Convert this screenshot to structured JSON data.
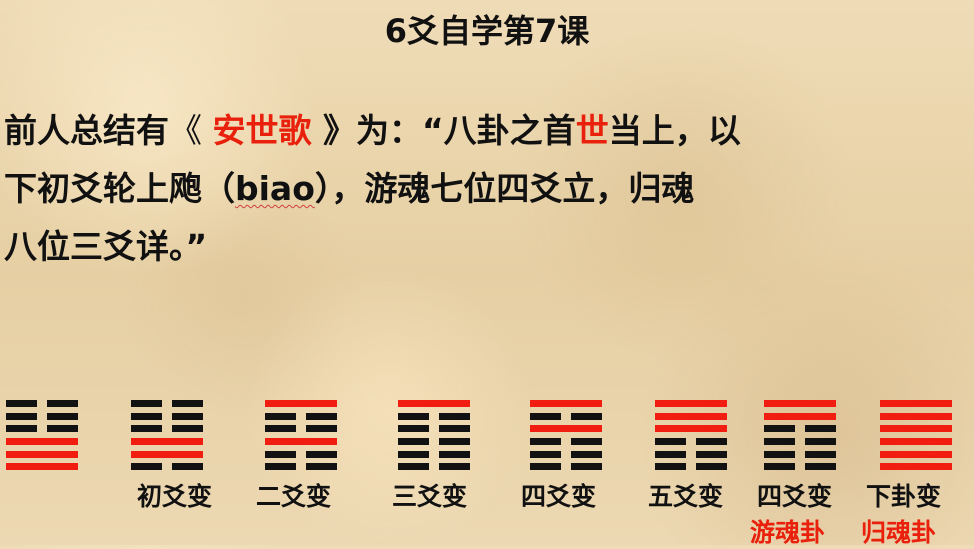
{
  "title": "6爻自学第7课",
  "paragraph": {
    "line1": {
      "a": "前人总结有",
      "b": "《 ",
      "c": "安世歌",
      "d": " 》为：“八卦之首",
      "e": "世",
      "f": "当上，以"
    },
    "line2": {
      "a": "下初爻轮上飑（",
      "b": "biao",
      "c": "），游魂七位四爻立，归魂"
    },
    "line3": {
      "a": "八位三爻详。”"
    }
  },
  "hexagrams": [
    {
      "label": "",
      "lines_bottom_to_top": [
        [
          "solid",
          "red"
        ],
        [
          "solid",
          "red"
        ],
        [
          "solid",
          "red"
        ],
        [
          "broken",
          "black"
        ],
        [
          "broken",
          "black"
        ],
        [
          "broken",
          "black"
        ]
      ]
    },
    {
      "label": "初爻变",
      "lines_bottom_to_top": [
        [
          "broken",
          "black"
        ],
        [
          "solid",
          "red"
        ],
        [
          "solid",
          "red"
        ],
        [
          "broken",
          "black"
        ],
        [
          "broken",
          "black"
        ],
        [
          "broken",
          "black"
        ]
      ]
    },
    {
      "label": "二爻变",
      "lines_bottom_to_top": [
        [
          "broken",
          "black"
        ],
        [
          "broken",
          "black"
        ],
        [
          "solid",
          "red"
        ],
        [
          "broken",
          "black"
        ],
        [
          "broken",
          "black"
        ],
        [
          "solid",
          "red"
        ]
      ]
    },
    {
      "label": "三爻变",
      "lines_bottom_to_top": [
        [
          "broken",
          "black"
        ],
        [
          "broken",
          "black"
        ],
        [
          "broken",
          "black"
        ],
        [
          "broken",
          "black"
        ],
        [
          "broken",
          "black"
        ],
        [
          "solid",
          "red"
        ]
      ]
    },
    {
      "label": "四爻变",
      "lines_bottom_to_top": [
        [
          "broken",
          "black"
        ],
        [
          "broken",
          "black"
        ],
        [
          "broken",
          "black"
        ],
        [
          "solid",
          "red"
        ],
        [
          "broken",
          "black"
        ],
        [
          "solid",
          "red"
        ]
      ]
    },
    {
      "label": "五爻变",
      "lines_bottom_to_top": [
        [
          "broken",
          "black"
        ],
        [
          "broken",
          "black"
        ],
        [
          "broken",
          "black"
        ],
        [
          "solid",
          "red"
        ],
        [
          "solid",
          "red"
        ],
        [
          "solid",
          "red"
        ]
      ]
    },
    {
      "label": "四爻变",
      "type": "游魂卦",
      "lines_bottom_to_top": [
        [
          "broken",
          "black"
        ],
        [
          "broken",
          "black"
        ],
        [
          "broken",
          "black"
        ],
        [
          "broken",
          "black"
        ],
        [
          "solid",
          "red"
        ],
        [
          "solid",
          "red"
        ]
      ]
    },
    {
      "label": "下卦变",
      "type": "归魂卦",
      "lines_bottom_to_top": [
        [
          "solid",
          "red"
        ],
        [
          "solid",
          "red"
        ],
        [
          "solid",
          "red"
        ],
        [
          "solid",
          "red"
        ],
        [
          "solid",
          "red"
        ],
        [
          "solid",
          "red"
        ]
      ]
    }
  ]
}
